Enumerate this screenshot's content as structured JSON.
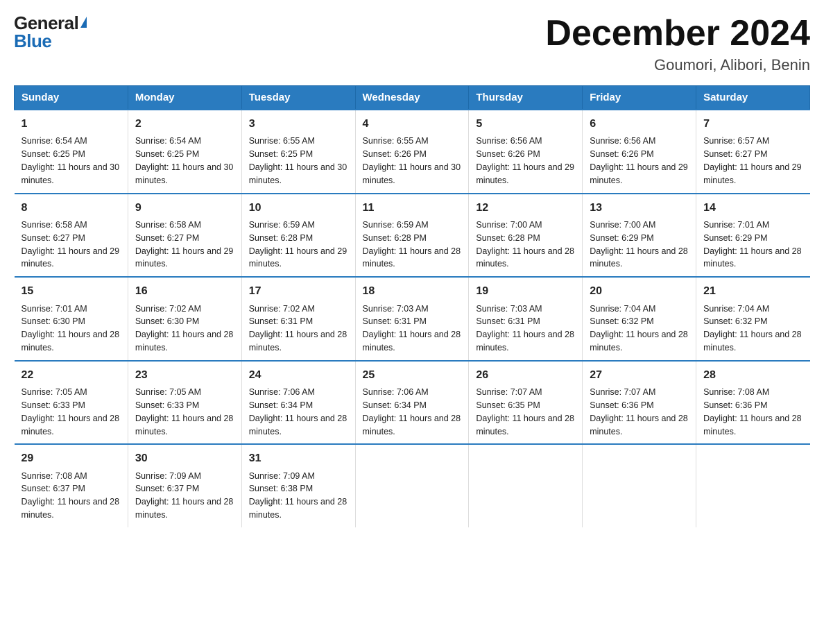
{
  "logo": {
    "general": "General",
    "blue": "Blue",
    "triangle": "▶"
  },
  "title": "December 2024",
  "location": "Goumori, Alibori, Benin",
  "days_of_week": [
    "Sunday",
    "Monday",
    "Tuesday",
    "Wednesday",
    "Thursday",
    "Friday",
    "Saturday"
  ],
  "weeks": [
    [
      {
        "day": "1",
        "sunrise": "6:54 AM",
        "sunset": "6:25 PM",
        "daylight": "11 hours and 30 minutes."
      },
      {
        "day": "2",
        "sunrise": "6:54 AM",
        "sunset": "6:25 PM",
        "daylight": "11 hours and 30 minutes."
      },
      {
        "day": "3",
        "sunrise": "6:55 AM",
        "sunset": "6:25 PM",
        "daylight": "11 hours and 30 minutes."
      },
      {
        "day": "4",
        "sunrise": "6:55 AM",
        "sunset": "6:26 PM",
        "daylight": "11 hours and 30 minutes."
      },
      {
        "day": "5",
        "sunrise": "6:56 AM",
        "sunset": "6:26 PM",
        "daylight": "11 hours and 29 minutes."
      },
      {
        "day": "6",
        "sunrise": "6:56 AM",
        "sunset": "6:26 PM",
        "daylight": "11 hours and 29 minutes."
      },
      {
        "day": "7",
        "sunrise": "6:57 AM",
        "sunset": "6:27 PM",
        "daylight": "11 hours and 29 minutes."
      }
    ],
    [
      {
        "day": "8",
        "sunrise": "6:58 AM",
        "sunset": "6:27 PM",
        "daylight": "11 hours and 29 minutes."
      },
      {
        "day": "9",
        "sunrise": "6:58 AM",
        "sunset": "6:27 PM",
        "daylight": "11 hours and 29 minutes."
      },
      {
        "day": "10",
        "sunrise": "6:59 AM",
        "sunset": "6:28 PM",
        "daylight": "11 hours and 29 minutes."
      },
      {
        "day": "11",
        "sunrise": "6:59 AM",
        "sunset": "6:28 PM",
        "daylight": "11 hours and 28 minutes."
      },
      {
        "day": "12",
        "sunrise": "7:00 AM",
        "sunset": "6:28 PM",
        "daylight": "11 hours and 28 minutes."
      },
      {
        "day": "13",
        "sunrise": "7:00 AM",
        "sunset": "6:29 PM",
        "daylight": "11 hours and 28 minutes."
      },
      {
        "day": "14",
        "sunrise": "7:01 AM",
        "sunset": "6:29 PM",
        "daylight": "11 hours and 28 minutes."
      }
    ],
    [
      {
        "day": "15",
        "sunrise": "7:01 AM",
        "sunset": "6:30 PM",
        "daylight": "11 hours and 28 minutes."
      },
      {
        "day": "16",
        "sunrise": "7:02 AM",
        "sunset": "6:30 PM",
        "daylight": "11 hours and 28 minutes."
      },
      {
        "day": "17",
        "sunrise": "7:02 AM",
        "sunset": "6:31 PM",
        "daylight": "11 hours and 28 minutes."
      },
      {
        "day": "18",
        "sunrise": "7:03 AM",
        "sunset": "6:31 PM",
        "daylight": "11 hours and 28 minutes."
      },
      {
        "day": "19",
        "sunrise": "7:03 AM",
        "sunset": "6:31 PM",
        "daylight": "11 hours and 28 minutes."
      },
      {
        "day": "20",
        "sunrise": "7:04 AM",
        "sunset": "6:32 PM",
        "daylight": "11 hours and 28 minutes."
      },
      {
        "day": "21",
        "sunrise": "7:04 AM",
        "sunset": "6:32 PM",
        "daylight": "11 hours and 28 minutes."
      }
    ],
    [
      {
        "day": "22",
        "sunrise": "7:05 AM",
        "sunset": "6:33 PM",
        "daylight": "11 hours and 28 minutes."
      },
      {
        "day": "23",
        "sunrise": "7:05 AM",
        "sunset": "6:33 PM",
        "daylight": "11 hours and 28 minutes."
      },
      {
        "day": "24",
        "sunrise": "7:06 AM",
        "sunset": "6:34 PM",
        "daylight": "11 hours and 28 minutes."
      },
      {
        "day": "25",
        "sunrise": "7:06 AM",
        "sunset": "6:34 PM",
        "daylight": "11 hours and 28 minutes."
      },
      {
        "day": "26",
        "sunrise": "7:07 AM",
        "sunset": "6:35 PM",
        "daylight": "11 hours and 28 minutes."
      },
      {
        "day": "27",
        "sunrise": "7:07 AM",
        "sunset": "6:36 PM",
        "daylight": "11 hours and 28 minutes."
      },
      {
        "day": "28",
        "sunrise": "7:08 AM",
        "sunset": "6:36 PM",
        "daylight": "11 hours and 28 minutes."
      }
    ],
    [
      {
        "day": "29",
        "sunrise": "7:08 AM",
        "sunset": "6:37 PM",
        "daylight": "11 hours and 28 minutes."
      },
      {
        "day": "30",
        "sunrise": "7:09 AM",
        "sunset": "6:37 PM",
        "daylight": "11 hours and 28 minutes."
      },
      {
        "day": "31",
        "sunrise": "7:09 AM",
        "sunset": "6:38 PM",
        "daylight": "11 hours and 28 minutes."
      },
      null,
      null,
      null,
      null
    ]
  ]
}
